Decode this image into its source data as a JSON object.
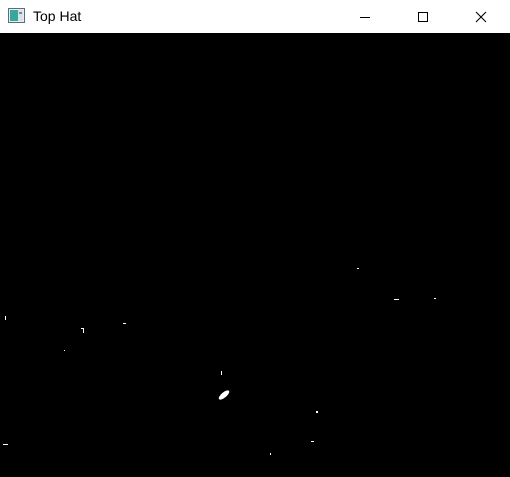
{
  "window": {
    "title": "Top Hat",
    "app_icon": "window-app-icon",
    "controls": [
      {
        "name": "minimize-button",
        "icon": "minimize-icon"
      },
      {
        "name": "maximize-button",
        "icon": "maximize-icon"
      },
      {
        "name": "close-button",
        "icon": "close-icon"
      }
    ]
  },
  "image": {
    "description_kind": "binary top-hat morphology result",
    "background_color": "#000000",
    "foreground_color": "#ffffff"
  }
}
